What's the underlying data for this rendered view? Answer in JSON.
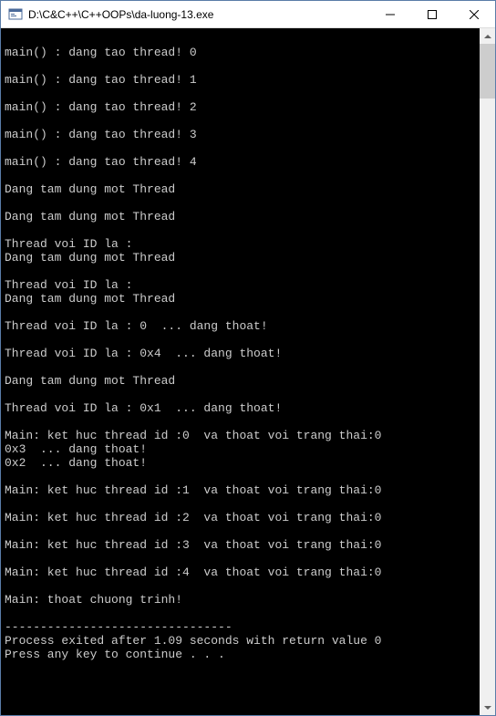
{
  "window": {
    "title": "D:\\C&C++\\C++OOPs\\da-luong-13.exe"
  },
  "console": {
    "lines": [
      "",
      "main() : dang tao thread! 0",
      "",
      "main() : dang tao thread! 1",
      "",
      "main() : dang tao thread! 2",
      "",
      "main() : dang tao thread! 3",
      "",
      "main() : dang tao thread! 4",
      "",
      "Dang tam dung mot Thread",
      "",
      "Dang tam dung mot Thread",
      "",
      "Thread voi ID la :",
      "Dang tam dung mot Thread",
      "",
      "Thread voi ID la :",
      "Dang tam dung mot Thread",
      "",
      "Thread voi ID la : 0  ... dang thoat!",
      "",
      "Thread voi ID la : 0x4  ... dang thoat!",
      "",
      "Dang tam dung mot Thread",
      "",
      "Thread voi ID la : 0x1  ... dang thoat!",
      "",
      "Main: ket huc thread id :0  va thoat voi trang thai:0",
      "0x3  ... dang thoat!",
      "0x2  ... dang thoat!",
      "",
      "Main: ket huc thread id :1  va thoat voi trang thai:0",
      "",
      "Main: ket huc thread id :2  va thoat voi trang thai:0",
      "",
      "Main: ket huc thread id :3  va thoat voi trang thai:0",
      "",
      "Main: ket huc thread id :4  va thoat voi trang thai:0",
      "",
      "Main: thoat chuong trinh!",
      "",
      "--------------------------------",
      "Process exited after 1.09 seconds with return value 0",
      "Press any key to continue . . ."
    ]
  }
}
